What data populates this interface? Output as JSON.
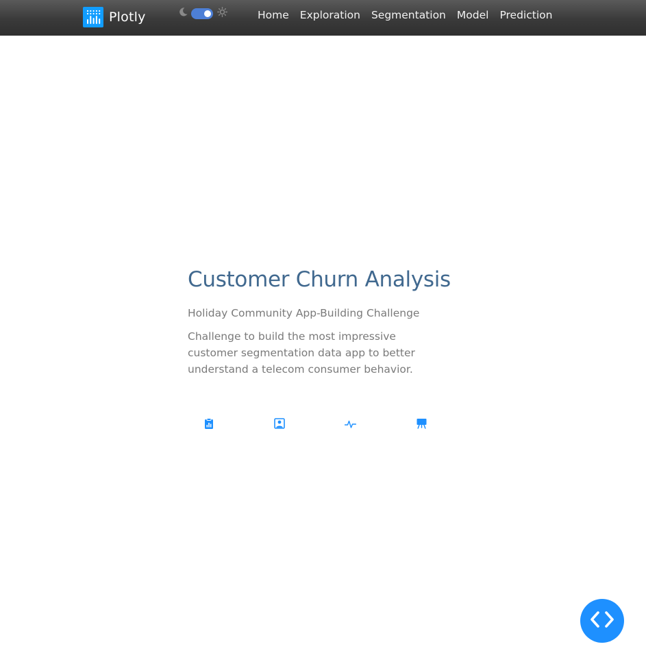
{
  "navbar": {
    "brand": "Plotly",
    "theme_toggle": {
      "state": "on",
      "left_icon": "moon-icon",
      "right_icon": "sun-icon"
    },
    "links": [
      {
        "label": "Home"
      },
      {
        "label": "Exploration"
      },
      {
        "label": "Segmentation"
      },
      {
        "label": "Model"
      },
      {
        "label": "Prediction"
      }
    ]
  },
  "hero": {
    "title": "Customer Churn Analysis",
    "subtitle": "Holiday Community App-Building Challenge",
    "description": "Challenge to build the most impressive customer segmentation data app to better understand a telecom consumer behavior."
  },
  "icon_links": [
    {
      "icon": "clipboard-chart-icon"
    },
    {
      "icon": "person-square-icon"
    },
    {
      "icon": "activity-icon"
    },
    {
      "icon": "easel-icon"
    }
  ],
  "colors": {
    "navbar_bg": "#3a3a3a",
    "brand_logo": "#119dff",
    "title": "#41698f",
    "body_text": "#7a7a7a",
    "icon_accent": "#1e90ff",
    "fab": "#1e90ff"
  }
}
